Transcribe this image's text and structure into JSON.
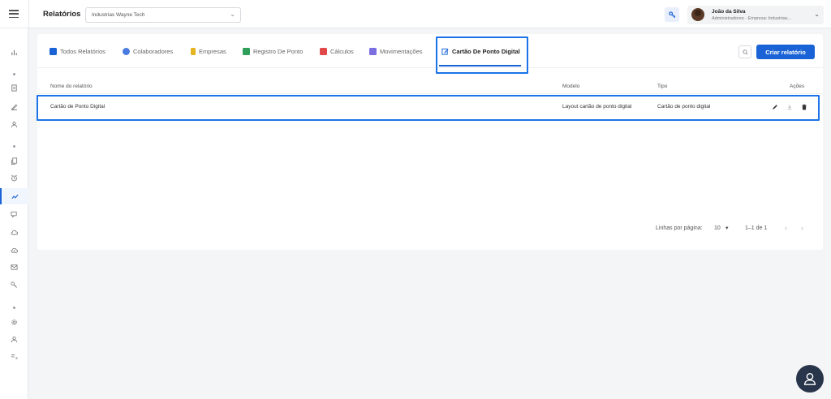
{
  "header": {
    "page_title": "Relatórios",
    "company_select_value": "Industrias Wayne Tech",
    "user_name": "João da Silva",
    "user_role": "Administradores - Empresa: Industrias..."
  },
  "tabs": [
    {
      "label": "Todos Relatórios",
      "icon": "report-icon",
      "color": "#1a63d6"
    },
    {
      "label": "Colaboradores",
      "icon": "people-icon",
      "color": "#4a7be0"
    },
    {
      "label": "Empresas",
      "icon": "building-icon",
      "color": "#e6b422"
    },
    {
      "label": "Registro De Ponto",
      "icon": "clock-record-icon",
      "color": "#2e9e5b"
    },
    {
      "label": "Cálculos",
      "icon": "calculator-icon",
      "color": "#e0484a"
    },
    {
      "label": "Movimentações",
      "icon": "movement-icon",
      "color": "#7a6ee0"
    },
    {
      "label": "Cartão De Ponto Digital",
      "icon": "digital-card-icon",
      "color": "#1a63d6"
    }
  ],
  "actions": {
    "create_label": "Criar relatório"
  },
  "table": {
    "headers": {
      "name": "Nome do relatório",
      "model": "Modelo",
      "type": "Tipo",
      "actions": "Ações"
    },
    "rows": [
      {
        "name": "Cartão de Ponto Digital",
        "model": "Layout cartão de ponto digital",
        "type": "Cartão de ponto digital"
      }
    ]
  },
  "pagination": {
    "rows_per_page_label": "Linhas por página:",
    "rows_per_page_value": "10",
    "range": "1–1 de 1"
  },
  "colors": {
    "accent": "#1a63d6",
    "highlight": "#1a73e8"
  }
}
